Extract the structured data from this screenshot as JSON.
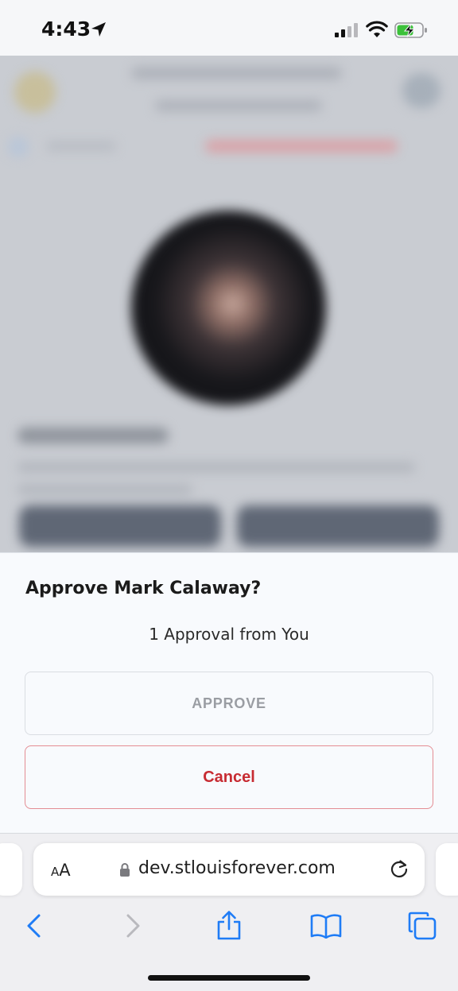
{
  "status_bar": {
    "time": "4:43",
    "icons": [
      "location-arrow-icon",
      "cellular-signal-icon",
      "wifi-icon",
      "battery-charging-icon"
    ],
    "battery_color": "#3cc13b"
  },
  "background_page": {
    "blurred": true,
    "accent_red": "#e5404b"
  },
  "dialog": {
    "title": "Approve Mark Calaway?",
    "subtitle": "1 Approval from You",
    "approve_label": "APPROVE",
    "cancel_label": "Cancel",
    "cancel_color": "#c72b32",
    "approve_disabled": true
  },
  "browser": {
    "reader_small": "A",
    "reader_big": "A",
    "address": "dev.stlouisforever.com",
    "toolbar_icons": [
      "back-icon",
      "forward-icon",
      "share-icon",
      "bookmarks-icon",
      "tabs-icon"
    ],
    "accent": "#1f7cf6"
  }
}
